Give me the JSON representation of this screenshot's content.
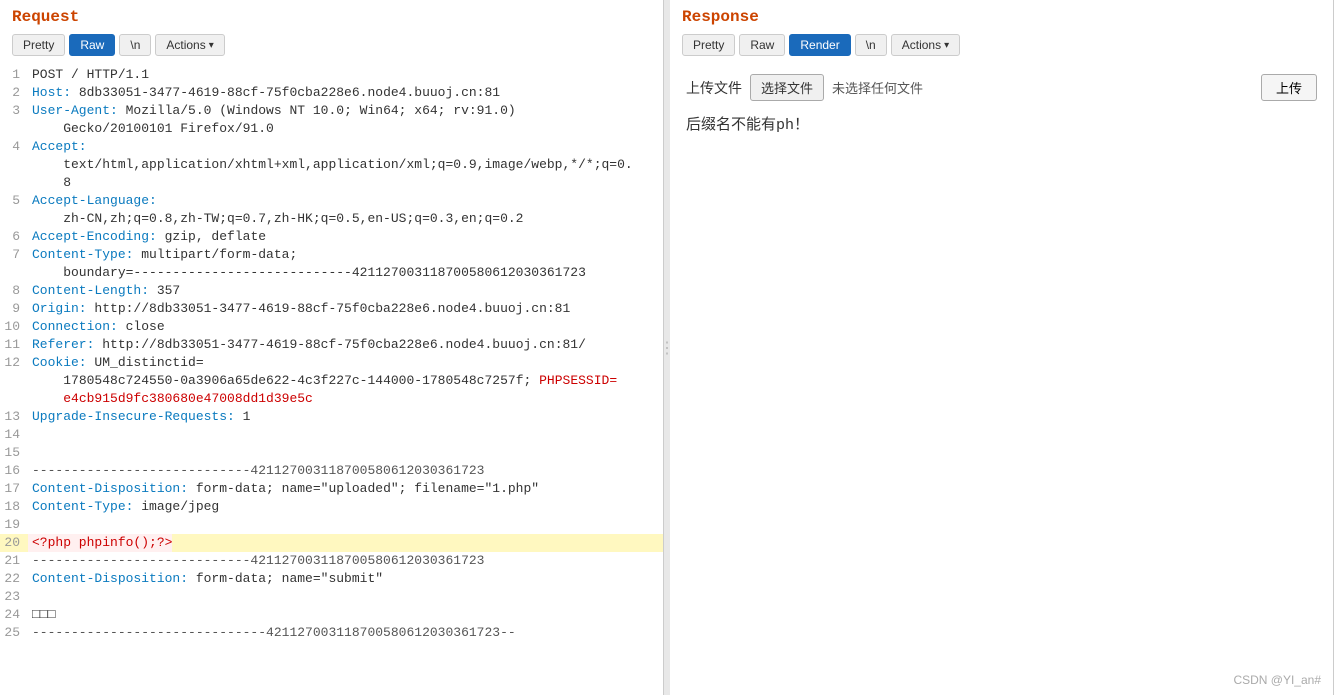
{
  "request": {
    "title": "Request",
    "tabs": [
      {
        "label": "Pretty",
        "active": false
      },
      {
        "label": "Raw",
        "active": true
      },
      {
        "label": "\\n",
        "active": false
      },
      {
        "label": "Actions",
        "active": false,
        "hasChevron": true
      }
    ],
    "lines": [
      {
        "num": 1,
        "content": "POST / HTTP/1.1",
        "type": "normal"
      },
      {
        "num": 2,
        "key": "Host:",
        "val": " 8db33051-3477-4619-88cf-75f0cba228e6.node4.buuoj.cn:81",
        "type": "kv"
      },
      {
        "num": 3,
        "key": "User-Agent:",
        "val": " Mozilla/5.0 (Windows NT 10.0; Win64; x64; rv:91.0)",
        "type": "kv"
      },
      {
        "num": "3b",
        "content": "    Gecko/20100101 Firefox/91.0",
        "type": "continuation"
      },
      {
        "num": 4,
        "key": "Accept:",
        "val": "",
        "type": "kv"
      },
      {
        "num": "4b",
        "content": "    text/html,application/xhtml+xml,application/xml;q=0.9,image/webp,*/*;q=0.",
        "type": "continuation"
      },
      {
        "num": "4c",
        "content": "    8",
        "type": "continuation"
      },
      {
        "num": 5,
        "key": "Accept-Language:",
        "val": "",
        "type": "kv"
      },
      {
        "num": "5b",
        "content": "    zh-CN,zh;q=0.8,zh-TW;q=0.7,zh-HK;q=0.5,en-US;q=0.3,en;q=0.2",
        "type": "continuation"
      },
      {
        "num": 6,
        "key": "Accept-Encoding:",
        "val": " gzip, deflate",
        "type": "kv"
      },
      {
        "num": 7,
        "key": "Content-Type:",
        "val": " multipart/form-data;",
        "type": "kv"
      },
      {
        "num": "7b",
        "content": "    boundary=----------------------------421127003118700580612030361723",
        "type": "continuation"
      },
      {
        "num": 8,
        "key": "Content-Length:",
        "val": " 357",
        "type": "kv"
      },
      {
        "num": 9,
        "key": "Origin:",
        "val": " http://8db33051-3477-4619-88cf-75f0cba228e6.node4.buuoj.cn:81",
        "type": "kv"
      },
      {
        "num": 10,
        "key": "Connection:",
        "val": " close",
        "type": "kv"
      },
      {
        "num": 11,
        "key": "Referer:",
        "val": " http://8db33051-3477-4619-88cf-75f0cba228e6.node4.buuoj.cn:81/",
        "type": "kv"
      },
      {
        "num": 12,
        "key": "Cookie:",
        "val": " UM_distinctid=",
        "type": "kv"
      },
      {
        "num": "12b",
        "content": "    1780548c724550-0a3906a65de622-4c3f227c-144000-1780548c7257f; PHPSESSID=",
        "type": "cookie-continuation",
        "special": true
      },
      {
        "num": "12c",
        "content": "    e4cb915d9fc380680e47008dd1d39e5c",
        "type": "continuation"
      },
      {
        "num": 13,
        "key": "Upgrade-Insecure-Requests:",
        "val": " 1",
        "type": "kv"
      },
      {
        "num": 14,
        "content": "",
        "type": "blank"
      },
      {
        "num": 15,
        "content": "",
        "type": "blank"
      },
      {
        "num": 16,
        "content": "----------------------------421127003118700580612030361723",
        "type": "separator-line"
      },
      {
        "num": 17,
        "key": "Content-Disposition:",
        "val": " form-data; name=\"uploaded\"; filename=\"1.php\"",
        "type": "kv"
      },
      {
        "num": 18,
        "key": "Content-Type:",
        "val": " image/jpeg",
        "type": "kv"
      },
      {
        "num": 19,
        "content": "",
        "type": "blank"
      },
      {
        "num": 20,
        "content": "<?php phpinfo();?>",
        "type": "php",
        "highlight": true
      },
      {
        "num": 21,
        "content": "----------------------------421127003118700580612030361723",
        "type": "separator-line"
      },
      {
        "num": 22,
        "key": "Content-Disposition:",
        "val": " form-data; name=\"submit\"",
        "type": "kv"
      },
      {
        "num": 23,
        "content": "",
        "type": "blank"
      },
      {
        "num": 24,
        "content": "□□□",
        "type": "normal"
      },
      {
        "num": 25,
        "content": "------------------------------421127003118700580612030361723--",
        "type": "separator-line"
      }
    ]
  },
  "response": {
    "title": "Response",
    "tabs": [
      {
        "label": "Pretty",
        "active": false
      },
      {
        "label": "Raw",
        "active": false
      },
      {
        "label": "Render",
        "active": true
      },
      {
        "label": "\\n",
        "active": false
      },
      {
        "label": "Actions",
        "active": false,
        "hasChevron": true
      }
    ],
    "upload": {
      "label": "上传文件",
      "choose_btn": "选择文件",
      "no_file": "未选择任何文件",
      "submit_btn": "上传"
    },
    "error_msg": "后缀名不能有ph！"
  },
  "watermark": "CSDN @YI_an#"
}
